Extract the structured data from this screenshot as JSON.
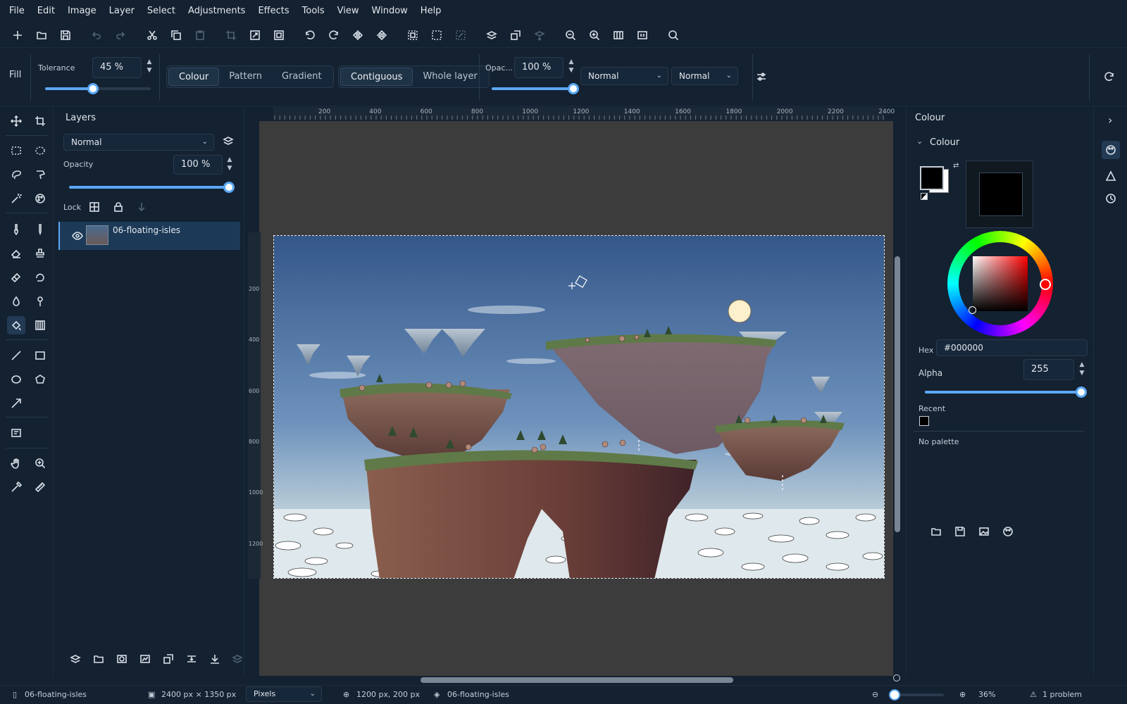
{
  "menu": [
    "File",
    "Edit",
    "Image",
    "Layer",
    "Select",
    "Adjustments",
    "Effects",
    "Tools",
    "View",
    "Window",
    "Help"
  ],
  "options": {
    "tool_name": "Fill",
    "tolerance_label": "Tolerance",
    "tolerance_value": "45 %",
    "tolerance_fraction": 0.45,
    "fill_modes": [
      "Colour",
      "Pattern",
      "Gradient"
    ],
    "fill_mode_selected": "Colour",
    "flood_modes": [
      "Contiguous",
      "Whole layer"
    ],
    "flood_mode_selected": "Contiguous",
    "opacity_label": "Opac...",
    "opacity_value": "100 %",
    "opacity_fraction": 1.0,
    "blend_mode_1": "Normal",
    "blend_mode_2": "Normal"
  },
  "layers": {
    "title": "Layers",
    "blend_mode": "Normal",
    "opacity_label": "Opacity",
    "opacity_value": "100 %",
    "opacity_fraction": 1.0,
    "lock_label": "Lock",
    "items": [
      {
        "name": "06-floating-isles",
        "visible": true,
        "selected": true
      }
    ]
  },
  "rulers": {
    "h_ticks": [
      "200",
      "400",
      "600",
      "800",
      "1000",
      "1200",
      "1400",
      "1600",
      "1800",
      "2000",
      "2200",
      "2400"
    ],
    "v_ticks": [
      "200",
      "400",
      "600",
      "800",
      "1000",
      "1200"
    ]
  },
  "colour_panel": {
    "panel_title": "Colour",
    "section_title": "Colour",
    "primary_color": "#000000",
    "secondary_color": "#ffffff",
    "hex_label": "Hex",
    "hex_value": "#000000",
    "alpha_label": "Alpha",
    "alpha_value": "255",
    "alpha_fraction": 1.0,
    "recent_label": "Recent",
    "recent_colors": [
      "#000000"
    ],
    "palette_text": "No palette"
  },
  "status": {
    "document": "06-floating-isles",
    "image_size": "2400 px × 1350 px",
    "units": "Pixels",
    "cursor_position": "1200 px, 200 px",
    "layer": "06-floating-isles",
    "zoom": "36%",
    "problems": "1 problem"
  },
  "colors": {
    "accent": "#5ba8f5",
    "background": "#132131",
    "canvas_bg": "#3c3c3c"
  }
}
